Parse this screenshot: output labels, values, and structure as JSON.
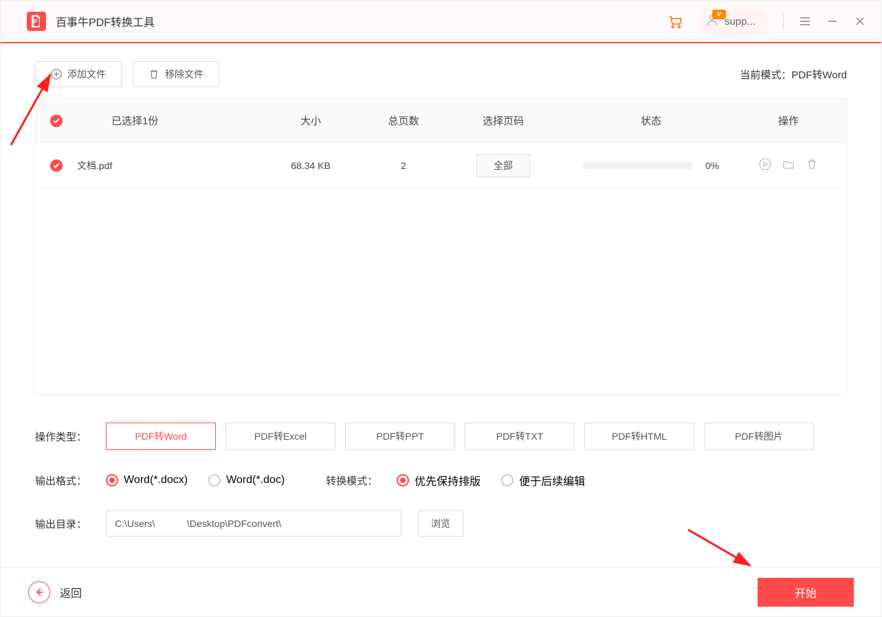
{
  "header": {
    "title": "百事牛PDF转换工具",
    "user_name": "supp..."
  },
  "toolbar": {
    "add_file": "添加文件",
    "remove_file": "移除文件",
    "mode_label": "当前模式：",
    "mode_value": "PDF转Word"
  },
  "table": {
    "headers": {
      "selected": "已选择1份",
      "size": "大小",
      "pages": "总页数",
      "page_select": "选择页码",
      "status": "状态",
      "ops": "操作"
    },
    "rows": [
      {
        "name": "文档.pdf",
        "size": "68.34 KB",
        "pages": "2",
        "page_select": "全部",
        "progress": "0%"
      }
    ]
  },
  "options": {
    "type_label": "操作类型：",
    "types": [
      "PDF转Word",
      "PDF转Excel",
      "PDF转PPT",
      "PDF转TXT",
      "PDF转HTML",
      "PDF转图片"
    ],
    "format_label": "输出格式：",
    "formats": [
      "Word(*.docx)",
      "Word(*.doc)"
    ],
    "mode_label": "转换模式：",
    "modes": [
      "优先保持排版",
      "便于后续编辑"
    ],
    "dir_label": "输出目录：",
    "dir_value": "C:\\Users\\            \\Desktop\\PDFconvert\\",
    "browse": "浏览"
  },
  "footer": {
    "back": "返回",
    "start": "开始"
  }
}
